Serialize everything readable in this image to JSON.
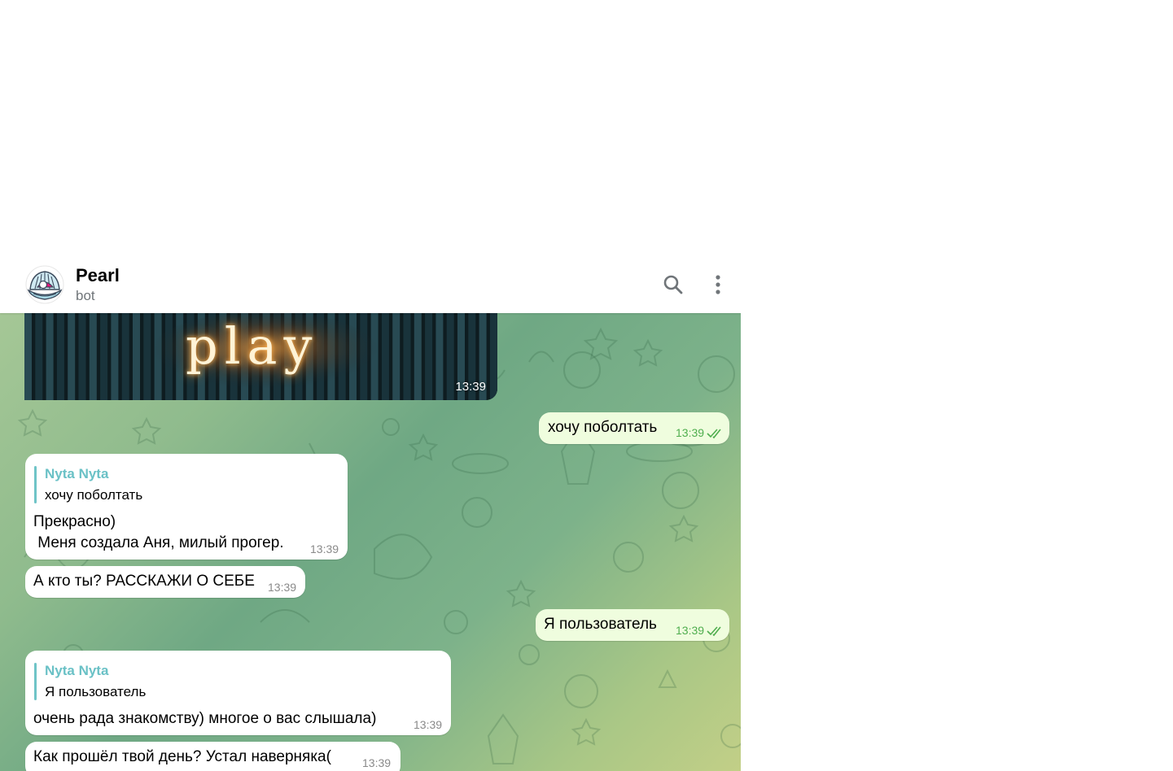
{
  "header": {
    "title": "Pearl",
    "subtitle": "bot",
    "avatar_icon": "pearl-shell-icon"
  },
  "photo": {
    "text": "play",
    "time": "13:39"
  },
  "messages": [
    {
      "dir": "out",
      "text": "хочу поболтать",
      "time": "13:39"
    },
    {
      "dir": "in",
      "reply_name": "Nyta Nyta",
      "reply_text": "хочу поболтать",
      "line1": "Прекрасно)",
      "line2": " Меня создала Аня, милый прогер.",
      "time": "13:39"
    },
    {
      "dir": "in",
      "text": "А кто ты? РАССКАЖИ О СЕБЕ",
      "time": "13:39"
    },
    {
      "dir": "out",
      "text": "Я пользователь",
      "time": "13:39"
    },
    {
      "dir": "in",
      "reply_name": "Nyta Nyta",
      "reply_text": "Я пользователь",
      "text": "очень рада знакомству) многое о вас слышала)",
      "time": "13:39"
    },
    {
      "dir": "in",
      "text": "Как прошёл твой день? Устал наверняка(",
      "time": "13:39"
    }
  ],
  "colors": {
    "outgoing_bubble": "#effdde",
    "incoming_bubble": "#ffffff",
    "accent": "#6ac1c6",
    "read_ticks": "#4fae4e"
  }
}
